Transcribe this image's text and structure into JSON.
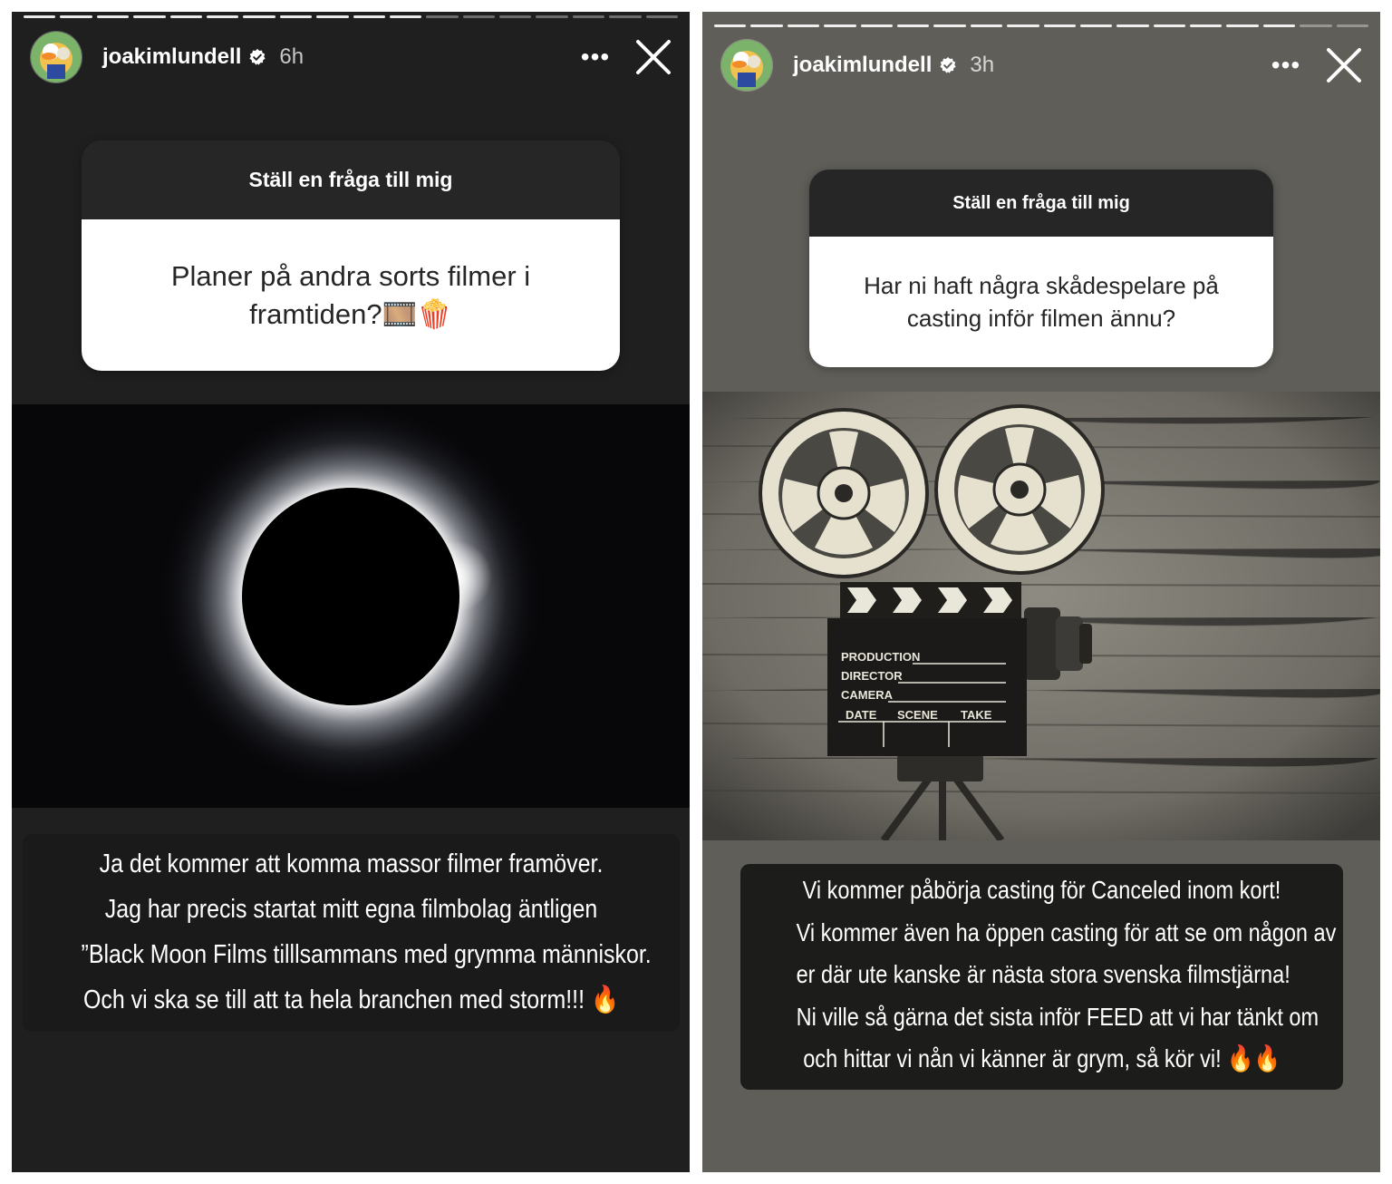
{
  "left_story": {
    "username": "joakimlundell",
    "time": "6h",
    "more_label": "•••",
    "progress_done": 11,
    "progress_total": 18,
    "question": {
      "prompt": "Ställ en fråga till mig",
      "text_line1": "Planer på andra sorts filmer i",
      "text_line2": "framtiden?🎞️🍿"
    },
    "caption_lines": [
      "Ja det kommer att komma massor filmer framöver.",
      "Jag har precis startat mitt egna filmbolag äntligen",
      "”Black Moon Films tilllsammans med grymma människor.",
      "Och vi ska se till att ta hela branchen med storm!!! 🔥"
    ]
  },
  "right_story": {
    "username": "joakimlundell",
    "time": "3h",
    "more_label": "•••",
    "progress_done": 16,
    "progress_total": 18,
    "question": {
      "prompt": "Ställ en fråga till mig",
      "text_line1": "Har ni haft några skådespelare på",
      "text_line2": "casting inför filmen ännu?"
    },
    "clapperboard": {
      "production": "PRODUCTION",
      "director": "DIRECTOR",
      "camera": "CAMERA",
      "date": "DATE",
      "scene": "SCENE",
      "take": "TAKE"
    },
    "caption_lines": [
      "Vi kommer påbörja casting för Canceled inom kort!",
      "Vi kommer även ha öppen casting för att se om någon av",
      "er där ute kanske är nästa stora svenska filmstjärna!",
      "Ni ville så gärna det sista inför FEED att vi har tänkt om",
      "och hittar vi nån vi känner är grym, så kör vi! 🔥🔥"
    ]
  },
  "icons": {
    "verified": "verified-badge-icon",
    "close": "close-x-icon",
    "more": "more-options-icon"
  }
}
